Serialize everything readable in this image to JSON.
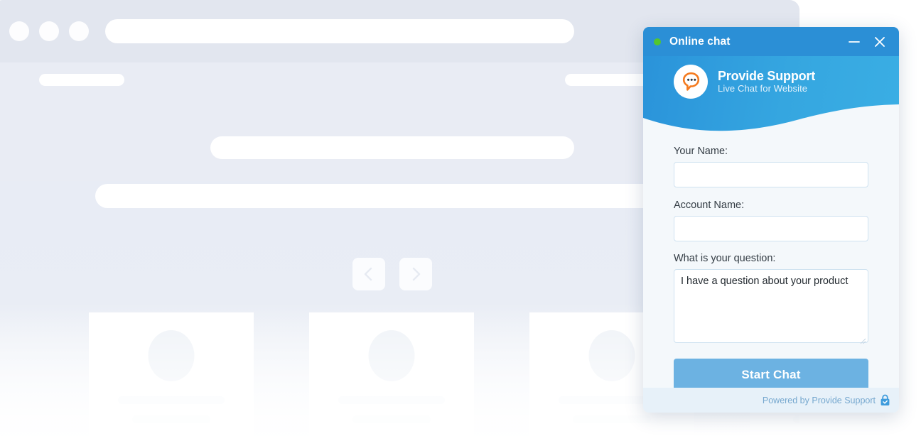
{
  "background_site": {
    "browser_dots": [
      "dot-1",
      "dot-2",
      "dot-3"
    ],
    "url_bar_placeholder": "",
    "carousel": {
      "prev_icon": "chevron-left-icon",
      "next_icon": "chevron-right-icon"
    },
    "cards": [
      {
        "avatar_icon": "avatar-placeholder"
      },
      {
        "avatar_icon": "avatar-placeholder"
      },
      {
        "avatar_icon": "avatar-placeholder"
      },
      {
        "avatar_icon": "avatar-placeholder"
      }
    ]
  },
  "chat_widget": {
    "header": {
      "status": "online",
      "status_color": "#53c62e",
      "title": "Online chat",
      "minimize_icon": "minimize-icon",
      "close_icon": "close-icon",
      "background_color": "#2b8fd6"
    },
    "brand": {
      "logo_icon": "provide-support-logo-icon",
      "name": "Provide Support",
      "tagline": "Live Chat for Website",
      "accent_color": "#f47b20",
      "background_color": "#35a6e0"
    },
    "form": {
      "name_label": "Your Name:",
      "name_value": "",
      "name_placeholder": "",
      "account_label": "Account Name:",
      "account_value": "",
      "account_placeholder": "",
      "question_label": "What is your question:",
      "question_value": "I have a question about your product",
      "question_placeholder": "",
      "submit_label": "Start Chat",
      "submit_color": "#6cb2e2"
    },
    "footer": {
      "powered_by": "Powered by Provide Support",
      "lock_icon": "secure-lock-icon",
      "text_color": "#76a8cf"
    }
  }
}
